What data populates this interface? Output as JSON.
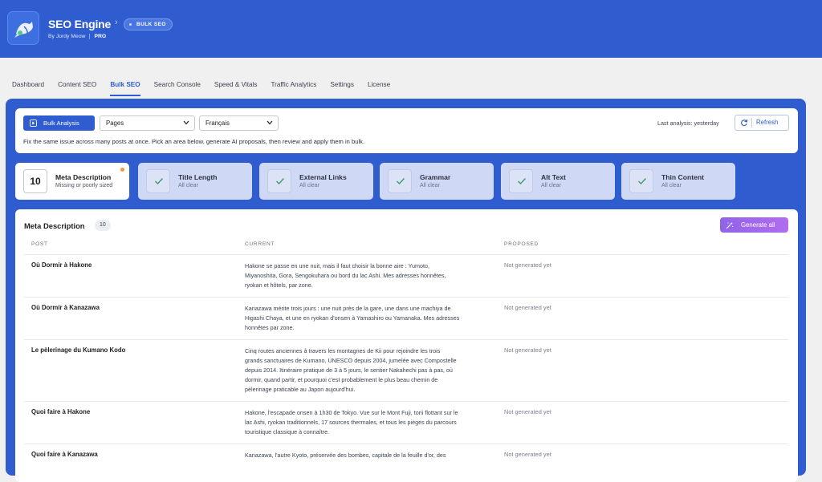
{
  "header": {
    "app_title": "SEO Engine",
    "breadcrumb_sep": "›",
    "badge": "BULK SEO",
    "byline": "By Jordy Meow",
    "pro": "PRO"
  },
  "tabs": [
    "Dashboard",
    "Content SEO",
    "Bulk SEO",
    "Search Console",
    "Speed & Vitals",
    "Traffic Analytics",
    "Settings",
    "License"
  ],
  "active_tab": "Bulk SEO",
  "toolbar": {
    "bulk_analysis_label": "Bulk Analysis",
    "post_type_select": "Pages",
    "language_select": "Français",
    "last_analysis": "Last analysis: yesterday",
    "refresh_label": "Refresh",
    "hint": "Fix the same issue across many posts at once. Pick an area below, generate AI proposals, then review and apply them in bulk."
  },
  "issues": [
    {
      "count": "10",
      "title": "Meta Description",
      "sub": "Missing or poorly sized",
      "active": true
    },
    {
      "title": "Title Length",
      "sub": "All clear"
    },
    {
      "title": "External Links",
      "sub": "All clear"
    },
    {
      "title": "Grammar",
      "sub": "All clear"
    },
    {
      "title": "Alt Text",
      "sub": "All clear"
    },
    {
      "title": "Thin Content",
      "sub": "All clear"
    }
  ],
  "table": {
    "title": "Meta Description",
    "count": "10",
    "generate_all_label": "Generate all",
    "columns": [
      "POST",
      "CURRENT",
      "PROPOSED"
    ],
    "rows": [
      {
        "post": "Où Dormir à Hakone",
        "current": [
          "Hakone se passe en une nuit, mais il faut choisir la bonne aire : Yumoto,",
          "Miyanoshita, Gora, Sengokuhara ou bord du lac Ashi. Mes adresses honnêtes,",
          "ryokan et hôtels, par zone."
        ],
        "proposed": "Not generated yet"
      },
      {
        "post": "Où Dormir à Kanazawa",
        "current": [
          "Kanazawa mérite trois jours : une nuit près de la gare, une dans une machiya de",
          "Higashi Chaya, et une en ryokan d'onsen à Yamashiro ou Yamanaka. Mes adresses",
          "honnêtes par zone."
        ],
        "proposed": "Not generated yet"
      },
      {
        "post": "Le pèlerinage du Kumano Kodo",
        "current": [
          "Cinq routes anciennes à travers les montagnes de Kii pour rejoindre les trois",
          "grands sanctuaires de Kumano. UNESCO depuis 2004, jumelée avec Compostelle",
          "depuis 2014. Itinéraire pratique de 3 à 5 jours, le sentier Nakahechi pas à pas, où",
          "dormir, quand partir, et pourquoi c'est probablement le plus beau chemin de",
          "pèlerinage praticable au Japon aujourd'hui."
        ],
        "proposed": "Not generated yet"
      },
      {
        "post": "Quoi faire à Hakone",
        "current": [
          "Hakone, l'escapade onsen à 1h30 de Tokyo. Vue sur le Mont Fuji, torii flottant sur le",
          "lac Ashi, ryokan traditionnels, 17 sources thermales, et tous les pièges du parcours",
          "touristique classique à connaître."
        ],
        "proposed": "Not generated yet"
      },
      {
        "post": "Quoi faire à Kanazawa",
        "current": [
          "Kanazawa, l'autre Kyoto, préservée des bombes, capitale de la feuille d'or, des"
        ],
        "proposed": "Not generated yet"
      }
    ]
  },
  "colors": {
    "brand": "#2f5ccf",
    "card_inactive": "#cfd8f4",
    "check": "#3e9a6c",
    "flag": "#f29a3a",
    "generate": "#9a65ea"
  },
  "icons": {
    "bulk_analysis": "play-icon",
    "select": "chevron-down-icon",
    "refresh": "refresh-icon",
    "issue_ok": "check-icon",
    "generate": "magic-wand-icon",
    "logo": "bird-logo-icon"
  }
}
